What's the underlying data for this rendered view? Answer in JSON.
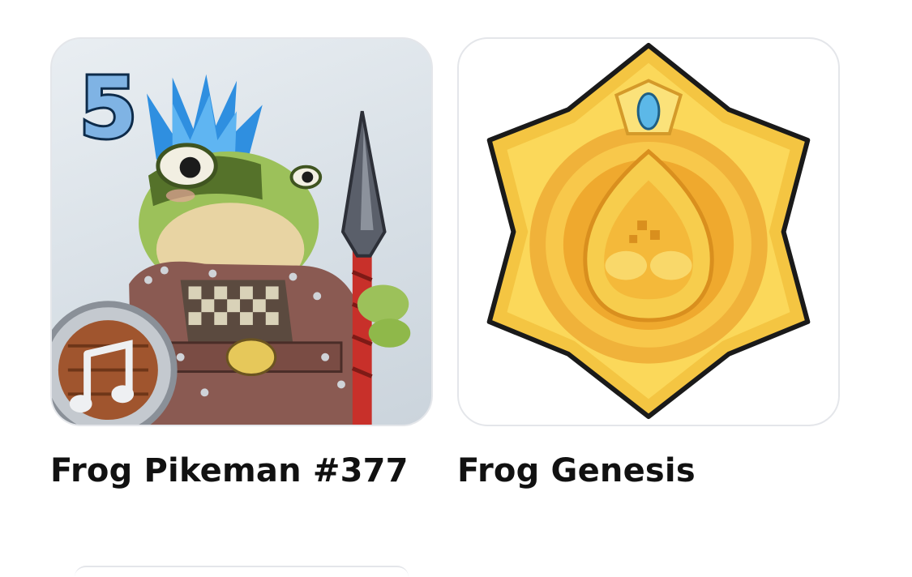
{
  "items": [
    {
      "title": "Frog Pikeman #377",
      "badge": "5",
      "image_icon": "frog-pikeman-art-icon"
    },
    {
      "title": "Frog Genesis",
      "image_icon": "gold-hexagram-medal-icon"
    }
  ],
  "colors": {
    "card_border": "#e4e6ea",
    "title_text": "#111111",
    "medal_gold": "#f4c542",
    "frog_green": "#8fb84a",
    "mohawk_blue": "#2f8fe0"
  }
}
